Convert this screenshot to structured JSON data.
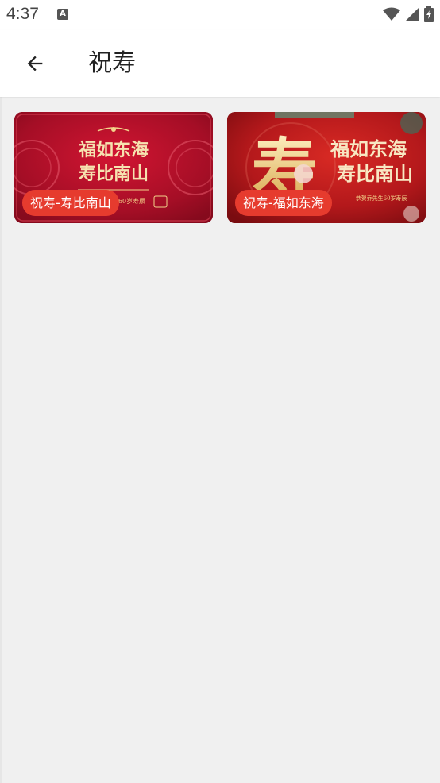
{
  "status_bar": {
    "time": "4:37",
    "notification_icon": "a-icon",
    "icons": [
      "wifi-icon",
      "signal-icon",
      "battery-icon"
    ]
  },
  "app_bar": {
    "back_icon": "arrow-back-icon",
    "title": "祝寿"
  },
  "cards": [
    {
      "label": "祝寿-寿比南山",
      "art_line1": "福如东海",
      "art_line2": "寿比南山",
      "art_caption": "60岁寿辰"
    },
    {
      "label": "祝寿-福如东海",
      "art_big_char": "寿",
      "art_line1": "福如东海",
      "art_line2": "寿比南山",
      "art_caption": "—— 恭贺乔先生60岁寿辰"
    }
  ],
  "colors": {
    "label_bg": "#e63b2e",
    "card_red": "#c8102e",
    "gold": "#f3d48a",
    "page_bg": "#f0f0f0"
  }
}
